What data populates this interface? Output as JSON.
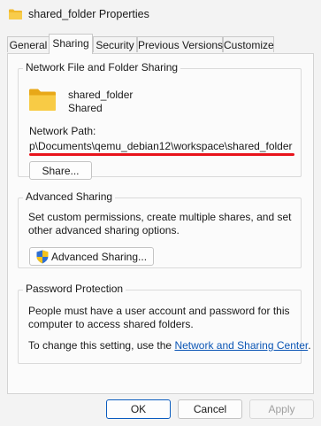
{
  "window": {
    "title": "shared_folder Properties"
  },
  "tabs": [
    {
      "label": "General"
    },
    {
      "label": "Sharing"
    },
    {
      "label": "Security"
    },
    {
      "label": "Previous Versions"
    },
    {
      "label": "Customize"
    }
  ],
  "network_sharing": {
    "heading": "Network File and Folder Sharing",
    "folder_name": "shared_folder",
    "folder_status": "Shared",
    "path_label": "Network Path:",
    "path_value": "p\\Documents\\qemu_debian12\\workspace\\shared_folder",
    "share_button": "Share..."
  },
  "advanced_sharing": {
    "heading": "Advanced Sharing",
    "description": "Set custom permissions, create multiple shares, and set other advanced sharing options.",
    "button": "Advanced Sharing..."
  },
  "password_protection": {
    "heading": "Password Protection",
    "description": "People must have a user account and password for this computer to access shared folders.",
    "change_text": "To change this setting, use the ",
    "link": "Network and Sharing Center",
    "change_suffix": "."
  },
  "footer": {
    "ok": "OK",
    "cancel": "Cancel",
    "apply": "Apply"
  },
  "colors": {
    "accent": "#0a55b5",
    "highlight_underline": "#e8131b",
    "folder": "#f5c542"
  }
}
